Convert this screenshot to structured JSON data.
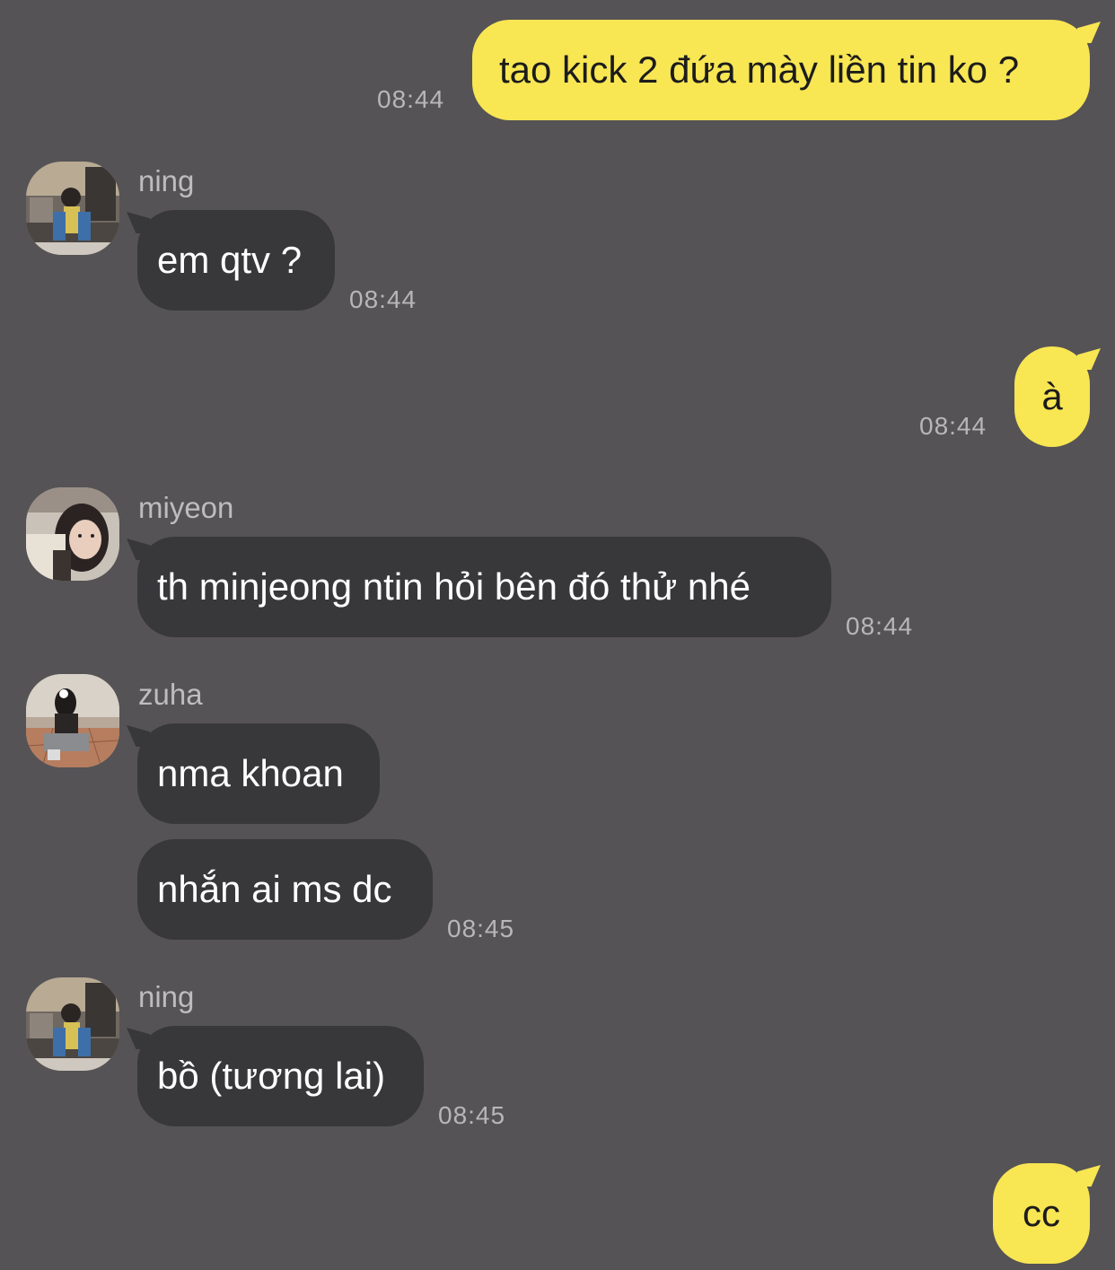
{
  "messages": [
    {
      "sender": "",
      "text": "tao kick 2 đứa mày liền tin ko ?",
      "time": "08:44"
    },
    {
      "sender": "ning",
      "text": "em qtv ?",
      "time": "08:44"
    },
    {
      "sender": "",
      "text": "à",
      "time": "08:44"
    },
    {
      "sender": "miyeon",
      "text": "th minjeong ntin hỏi bên đó thử nhé",
      "time": "08:44"
    },
    {
      "sender": "zuha",
      "text": "nma khoan",
      "time": ""
    },
    {
      "sender": "zuha",
      "text": "nhắn ai ms dc",
      "time": "08:45"
    },
    {
      "sender": "ning",
      "text": "bồ (tương lai)",
      "time": "08:45"
    },
    {
      "sender": "",
      "text": "cc",
      "time": ""
    }
  ],
  "colors": {
    "background": "#555355",
    "incoming_bubble": "#38373a",
    "outgoing_bubble": "#f8e653",
    "timestamp": "#b7b6b8"
  }
}
